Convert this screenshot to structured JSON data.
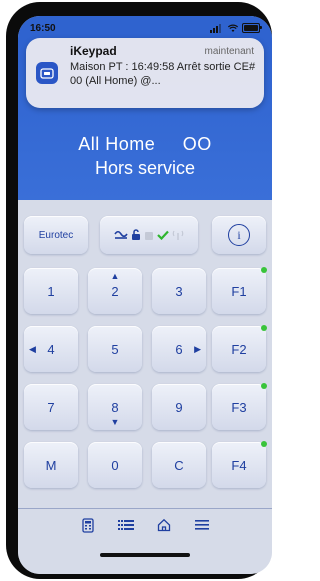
{
  "status_bar": {
    "time": "16:50"
  },
  "notification": {
    "app_name": "iKeypad",
    "time": "maintenant",
    "body": "Maison PT  : 16:49:58 Arrêt sortie CE# 00 (All Home) @..."
  },
  "display": {
    "line1": "All Home     OO",
    "line2": "Hors service"
  },
  "toolbar": {
    "brand_label": "Eurotec",
    "info_label": "i"
  },
  "keypad": {
    "keys": [
      {
        "label": "1",
        "arrow": ""
      },
      {
        "label": "2",
        "arrow": "up"
      },
      {
        "label": "3",
        "arrow": ""
      },
      {
        "label": "F1",
        "arrow": "",
        "indicator": true
      },
      {
        "label": "4",
        "arrow": "left"
      },
      {
        "label": "5",
        "arrow": ""
      },
      {
        "label": "6",
        "arrow": "right"
      },
      {
        "label": "F2",
        "arrow": "",
        "indicator": true
      },
      {
        "label": "7",
        "arrow": ""
      },
      {
        "label": "8",
        "arrow": "down"
      },
      {
        "label": "9",
        "arrow": ""
      },
      {
        "label": "F3",
        "arrow": "",
        "indicator": true
      },
      {
        "label": "M",
        "arrow": ""
      },
      {
        "label": "0",
        "arrow": ""
      },
      {
        "label": "C",
        "arrow": ""
      },
      {
        "label": "F4",
        "arrow": "",
        "indicator": true
      }
    ]
  },
  "tabbar": {
    "items": [
      {
        "icon": "keypad-icon"
      },
      {
        "icon": "grid-list-icon"
      },
      {
        "icon": "home-icon"
      },
      {
        "icon": "menu-icon"
      }
    ]
  },
  "colors": {
    "display_blue": "#2f63cf",
    "key_text": "#1f3fa0",
    "indicator_green": "#39c43a"
  }
}
